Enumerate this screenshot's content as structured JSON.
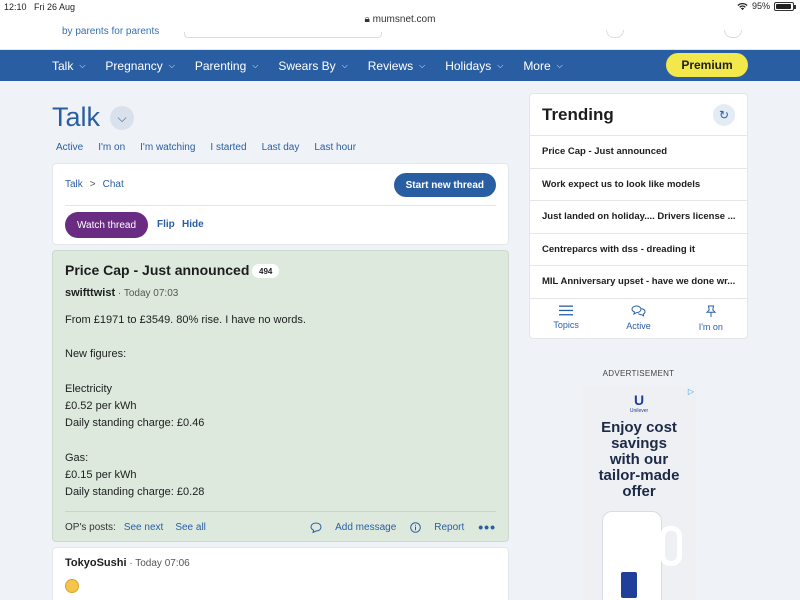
{
  "status_bar": {
    "time": "12:10",
    "date": "Fri 26 Aug",
    "battery": "95%",
    "battery_level": 0.95
  },
  "browser": {
    "url": "mumsnet.com"
  },
  "site": {
    "tagline": "by parents for parents"
  },
  "nav": {
    "items": [
      "Talk",
      "Pregnancy",
      "Parenting",
      "Swears By",
      "Reviews",
      "Holidays",
      "More"
    ],
    "premium_label": "Premium"
  },
  "talk": {
    "title": "Talk",
    "filters": [
      "Active",
      "I'm on",
      "I'm watching",
      "I started",
      "Last day",
      "Last hour"
    ]
  },
  "breadcrumb": {
    "items": [
      "Talk",
      "Chat"
    ],
    "separator": ">"
  },
  "thread_actions": {
    "start_new_thread": "Start new thread",
    "watch_thread": "Watch thread",
    "flip": "Flip",
    "hide": "Hide"
  },
  "thread": {
    "title": "Price Cap - Just announced",
    "count": "494",
    "op": {
      "author": "swifttwist",
      "time": "· Today 07:03",
      "lines": [
        "From £1971 to £3549. 80% rise. I have no words.",
        "",
        "New figures:",
        "",
        "Electricity",
        "£0.52 per kWh",
        "Daily standing charge: £0.46",
        "",
        "Gas:",
        "£0.15 per kWh",
        "Daily standing charge: £0.28"
      ]
    },
    "footer": {
      "ops_posts": "OP's posts:",
      "see_next": "See next",
      "see_all": "See all",
      "add_message": "Add message",
      "report": "Report"
    }
  },
  "reply": {
    "author": "TokyoSushi",
    "time": "· Today 07:06"
  },
  "trending": {
    "title": "Trending",
    "items": [
      "Price Cap - Just announced",
      "Work expect us to look like models",
      "Just landed on holiday.... Drivers license ...",
      "Centreparcs with dss - dreading it",
      "MIL Anniversary upset - have we done wr..."
    ],
    "tabs": [
      "Topics",
      "Active",
      "I'm on"
    ]
  },
  "ad": {
    "label": "ADVERTISEMENT",
    "brand": "Unilever",
    "headline_lines": [
      "Enjoy cost",
      "savings",
      "with our",
      "tailor-made",
      "offer"
    ]
  },
  "colors": {
    "brand_blue": "#2a5ea3",
    "premium_yellow": "#f2e84b",
    "watch_purple": "#6a2c82",
    "op_post_bg": "#dde9dd"
  }
}
